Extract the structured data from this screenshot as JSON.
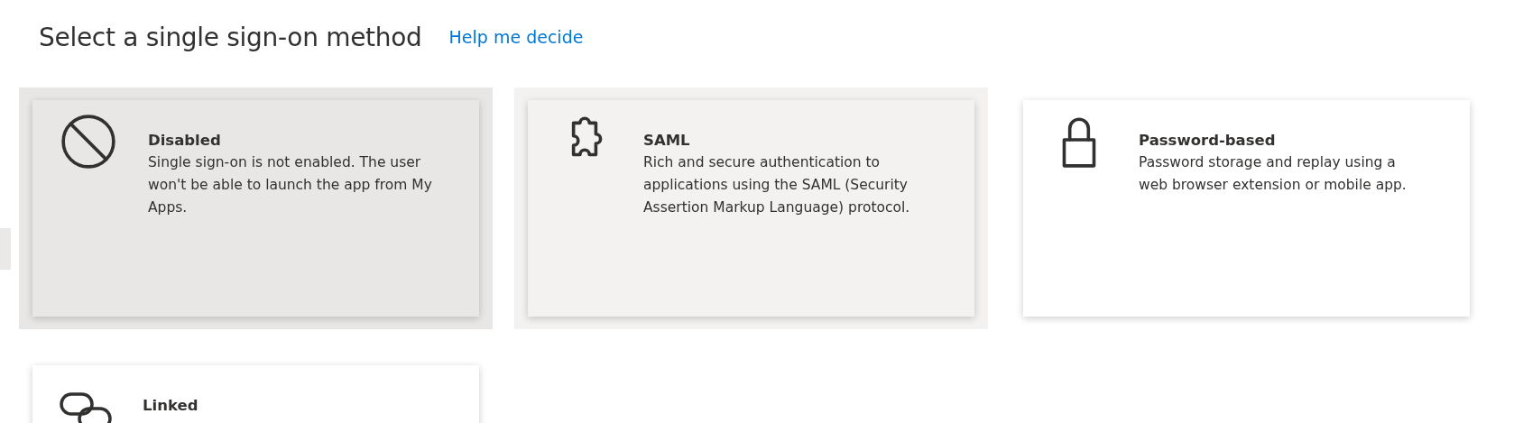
{
  "header": {
    "title": "Select a single sign-on method",
    "link": "Help me decide"
  },
  "methods": [
    {
      "kind": "disabled",
      "title": "Disabled",
      "description": "Single sign-on is not enabled. The user won't be able to launch the app from My Apps.",
      "selected": true,
      "hovered": false
    },
    {
      "kind": "saml",
      "title": "SAML",
      "description": "Rich and secure authentication to applications using the SAML (Security Assertion Markup Language) protocol.",
      "selected": false,
      "hovered": true
    },
    {
      "kind": "password",
      "title": "Password-based",
      "description": "Password storage and replay using a web browser extension or mobile app.",
      "selected": false,
      "hovered": false
    },
    {
      "kind": "linked",
      "title": "Linked",
      "selected": false,
      "hovered": false
    }
  ]
}
